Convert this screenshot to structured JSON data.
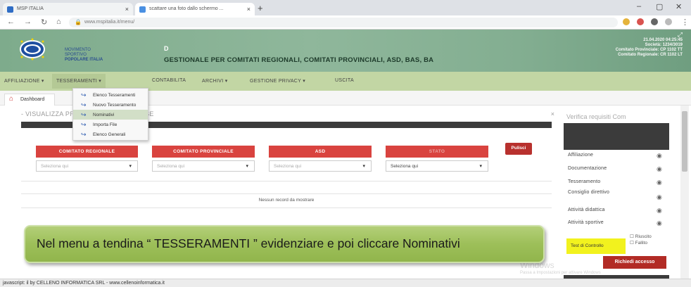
{
  "browser": {
    "tabs": [
      {
        "title": "MSP ITALIA",
        "color": "#2f6dc5"
      },
      {
        "title": "scattare una foto dallo schermo ...",
        "color": "#4a90e2"
      }
    ],
    "new_tab_symbol": "+",
    "window_controls": [
      "–",
      "▢",
      "✕"
    ],
    "url": "www.mspitalia.it/menu/",
    "nav_back": "←",
    "nav_forward": "→",
    "nav_reload": "↻",
    "nav_home": "⌂",
    "menu_dots": "⋮"
  },
  "header": {
    "brand_line1": "MOVIMENTO",
    "brand_line2": "SPORTIVO",
    "brand_line3": "POPOLARE ITALIA",
    "caret": "D",
    "title": "GESTIONALE PER COMITATI REGIONALI, COMITATI PROVINCIALI, ASD, BAS, BA",
    "info_line1": "21.04.2020 04:25:45",
    "info_line2": "Società: 1234/3019",
    "info_line3": "Comitato Provinciale: CP 1102 TT",
    "info_line4": "Comitato Regionale: CR 1102 LT",
    "expand_icon": "⤢"
  },
  "menubar": {
    "items": [
      {
        "label": "AFFILIAZIONE",
        "arrow": true
      },
      {
        "label": "TESSERAMENTI",
        "arrow": true
      },
      {
        "label": "CONTABILITA",
        "arrow": false
      },
      {
        "label": "ARCHIVI",
        "arrow": true
      },
      {
        "label": "GESTIONE PRIVACY",
        "arrow": true
      },
      {
        "label": "USCITA",
        "arrow": false
      }
    ]
  },
  "dashboard_tab": {
    "label": "Dashboard",
    "icon": "⌂"
  },
  "dropdown": {
    "items": [
      {
        "label": "Elenco Tesseramenti",
        "highlighted": false
      },
      {
        "label": "Nuovo Tesseramento",
        "highlighted": false
      },
      {
        "label": "Nominativi",
        "highlighted": true
      },
      {
        "label": "Importa File",
        "highlighted": false
      },
      {
        "label": "Elenco Generali",
        "highlighted": false
      }
    ]
  },
  "main_panel": {
    "title": "- VISUALIZZA PRATICHE APERTE/CHIUSE",
    "close_icon": "×",
    "filters": [
      {
        "header": "COMITATO REGIONALE",
        "placeholder": "Seleziona qui"
      },
      {
        "header": "COMITATO PROVINCIALE",
        "placeholder": "Seleziona qui"
      },
      {
        "header": "ASD",
        "placeholder": "Seleziona qui"
      },
      {
        "header": "STATO",
        "placeholder": "Seleziona qui"
      }
    ],
    "caret": "▾",
    "clear_button": "Pulisci",
    "no_records": "Nessun record da mostrare"
  },
  "right_panel": {
    "title": "Verifica requisiti Com",
    "rows": [
      "Affiliazione",
      "Documentazione",
      "Tesseramento",
      "Consiglio direttivo",
      "Attività didattica",
      "Attività sportive"
    ],
    "eye_icon": "◉",
    "test_label": "Test di Controllo",
    "test_opt1": "Riuscito",
    "test_opt2": "Fallito",
    "request_button": "Richiedi accesso",
    "watermark": "Windows",
    "watermark_sub": "Passa a Impostazioni per attivare Windows"
  },
  "caption": {
    "text": "Nel menu a tendina “ TESSERAMENTI ” evidenziare e poi cliccare Nominativi"
  },
  "statusbar": {
    "text": "javascript: il by CELLENO INFORMATICA SRL - www.cellenoinformatica.it"
  }
}
